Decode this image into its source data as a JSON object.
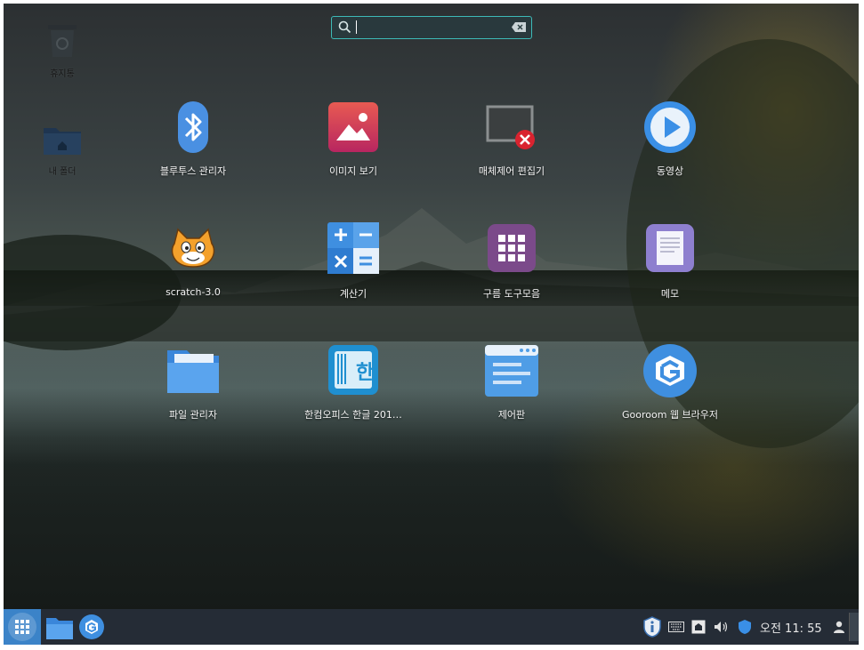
{
  "desktop": {
    "trash_label": "휴지통",
    "home_label": "내 폴더"
  },
  "search": {
    "value": "",
    "placeholder": ""
  },
  "apps": [
    {
      "label": "블루투스 관리자",
      "icon": "bluetooth-icon"
    },
    {
      "label": "이미지 보기",
      "icon": "image-viewer-icon"
    },
    {
      "label": "매체제어 편집기",
      "icon": "media-control-editor-icon"
    },
    {
      "label": "동영상",
      "icon": "video-player-icon"
    },
    {
      "label": "scratch-3.0",
      "icon": "scratch-cat-icon"
    },
    {
      "label": "계산기",
      "icon": "calculator-icon"
    },
    {
      "label": "구름 도구모음",
      "icon": "gooroom-tools-icon"
    },
    {
      "label": "메모",
      "icon": "memo-icon"
    },
    {
      "label": "파일 관리자",
      "icon": "file-manager-icon"
    },
    {
      "label": "한컴오피스 한글 201…",
      "icon": "hancom-hangul-icon"
    },
    {
      "label": "제어판",
      "icon": "control-panel-icon"
    },
    {
      "label": "Gooroom 웹 브라우저",
      "icon": "gooroom-browser-icon"
    }
  ],
  "taskbar": {
    "clock": "오전 11: 55",
    "accent": "#3b83c8",
    "background": "#252c36"
  },
  "colors": {
    "search_border": "#3dbab7",
    "bluetooth": "#4a90e2",
    "image_viewer": "#d0345e",
    "video": "#3a8fe6",
    "calculator": "#3f8fe0",
    "tools": "#7b4a8a",
    "memo": "#8e7fcf",
    "folder": "#4d9ae8",
    "hancom": "#1f8fd0",
    "control_panel": "#4f9de6",
    "browser": "#3f8fe0"
  }
}
